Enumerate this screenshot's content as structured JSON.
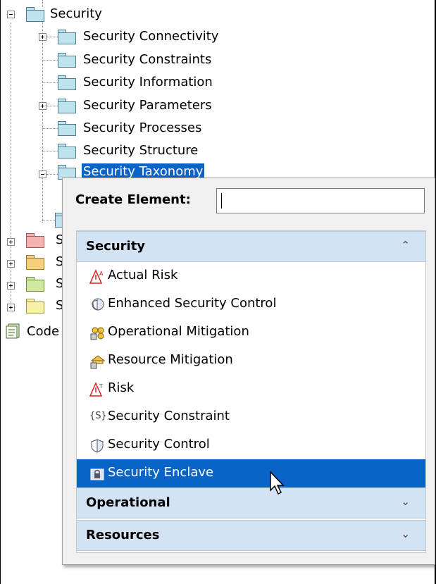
{
  "tree": {
    "root": {
      "label": "Security",
      "expanded": true
    },
    "children": [
      {
        "label": "Security Connectivity",
        "expander": "plus"
      },
      {
        "label": "Security Constraints",
        "expander": "none"
      },
      {
        "label": "Security Information",
        "expander": "none"
      },
      {
        "label": "Security Parameters",
        "expander": "plus"
      },
      {
        "label": "Security Processes",
        "expander": "none"
      },
      {
        "label": "Security Structure",
        "expander": "none"
      },
      {
        "label": "Security Taxonomy",
        "expander": "minus",
        "selected": true
      }
    ],
    "siblings": [
      {
        "label": "S",
        "color": "#f7b1b1"
      },
      {
        "label": "S",
        "color": "#f5cf7e"
      },
      {
        "label": "S",
        "color": "#cfe9a0"
      },
      {
        "label": "S",
        "color": "#f7f0a8"
      }
    ],
    "code_item": {
      "label": "Code",
      "icon": "code-document-icon"
    }
  },
  "popup": {
    "create_label": "Create Element:",
    "search_value": "",
    "groups": [
      {
        "label": "Security",
        "expanded": true,
        "items": [
          {
            "label": "Actual Risk",
            "icon": "actual-risk-icon"
          },
          {
            "label": "Enhanced Security Control",
            "icon": "enhanced-security-control-icon"
          },
          {
            "label": "Operational Mitigation",
            "icon": "operational-mitigation-icon"
          },
          {
            "label": "Resource Mitigation",
            "icon": "resource-mitigation-icon"
          },
          {
            "label": "Risk",
            "icon": "risk-icon"
          },
          {
            "label": "Security Constraint",
            "icon": "security-constraint-icon",
            "glyph": "{S}"
          },
          {
            "label": "Security Control",
            "icon": "security-control-icon"
          },
          {
            "label": "Security Enclave",
            "icon": "security-enclave-icon",
            "selected": true
          }
        ]
      },
      {
        "label": "Operational",
        "expanded": false
      },
      {
        "label": "Resources",
        "expanded": false
      }
    ]
  },
  "colors": {
    "selection": "#0a64c8",
    "group_header": "#d4e3f4",
    "folder_blue": "#bfe4f0"
  }
}
